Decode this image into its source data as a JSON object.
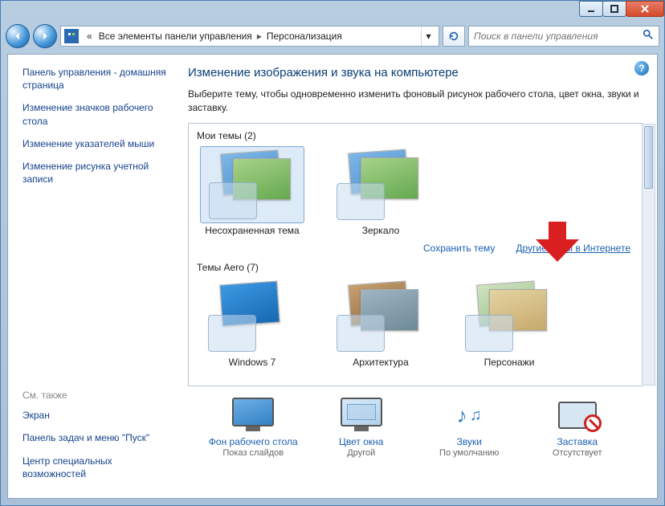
{
  "breadcrumb": {
    "root_prefix": "«",
    "root": "Все элементы панели управления",
    "current": "Персонализация"
  },
  "search": {
    "placeholder": "Поиск в панели управления"
  },
  "sidebar": {
    "home": "Панель управления - домашняя страница",
    "links": [
      "Изменение значков рабочего стола",
      "Изменение указателей мыши",
      "Изменение рисунка учетной записи"
    ],
    "see_also_header": "См. также",
    "see_also": [
      "Экран",
      "Панель задач и меню \"Пуск\"",
      "Центр специальных возможностей"
    ]
  },
  "main": {
    "title": "Изменение изображения и звука на компьютере",
    "desc": "Выберите тему, чтобы одновременно изменить фоновый рисунок рабочего стола, цвет окна, звуки и заставку.",
    "my_themes_header": "Мои темы (2)",
    "my_themes": [
      {
        "label": "Несохраненная тема"
      },
      {
        "label": "Зеркало"
      }
    ],
    "save_theme": "Сохранить тему",
    "more_themes": "Другие темы в Интернете",
    "aero_header": "Темы Aero (7)",
    "aero_themes": [
      {
        "label": "Windows 7"
      },
      {
        "label": "Архитектура"
      },
      {
        "label": "Персонажи"
      }
    ]
  },
  "bottom": {
    "bg": {
      "label": "Фон рабочего стола",
      "sub": "Показ слайдов"
    },
    "color": {
      "label": "Цвет окна",
      "sub": "Другой"
    },
    "sound": {
      "label": "Звуки",
      "sub": "По умолчанию"
    },
    "saver": {
      "label": "Заставка",
      "sub": "Отсутствует"
    }
  }
}
